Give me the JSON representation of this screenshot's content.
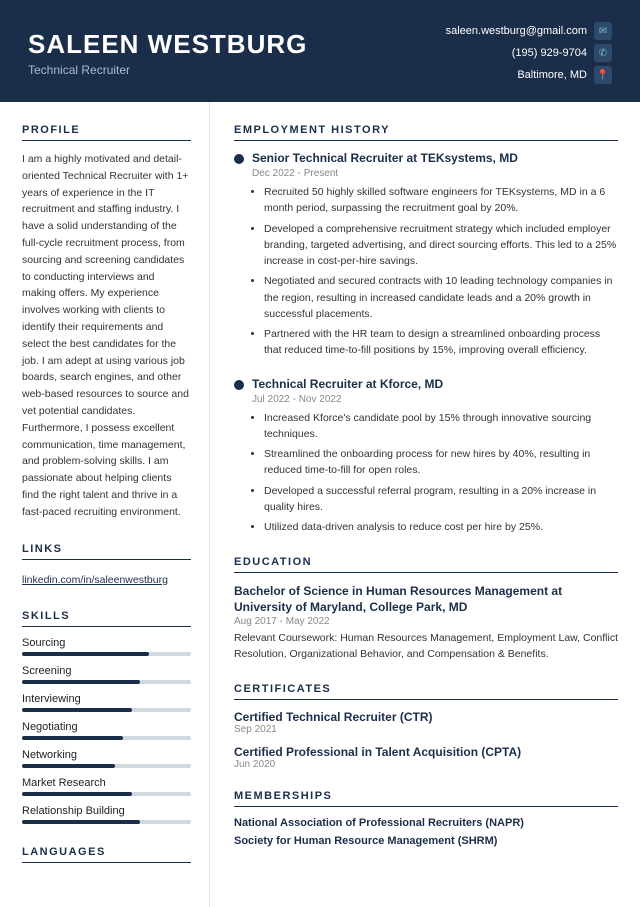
{
  "header": {
    "name": "SALEEN WESTBURG",
    "title": "Technical Recruiter",
    "email": "saleen.westburg@gmail.com",
    "phone": "(195) 929-9704",
    "location": "Baltimore, MD"
  },
  "sidebar": {
    "sections": {
      "profile": {
        "title": "PROFILE",
        "text": "I am a highly motivated and detail-oriented Technical Recruiter with 1+ years of experience in the IT recruitment and staffing industry. I have a solid understanding of the full-cycle recruitment process, from sourcing and screening candidates to conducting interviews and making offers. My experience involves working with clients to identify their requirements and select the best candidates for the job. I am adept at using various job boards, search engines, and other web-based resources to source and vet potential candidates. Furthermore, I possess excellent communication, time management, and problem-solving skills. I am passionate about helping clients find the right talent and thrive in a fast-paced recruiting environment."
      },
      "links": {
        "title": "LINKS",
        "items": [
          "linkedin.com/in/saleenwestburg"
        ]
      },
      "skills": {
        "title": "SKILLS",
        "items": [
          {
            "label": "Sourcing",
            "pct": 75
          },
          {
            "label": "Screening",
            "pct": 70
          },
          {
            "label": "Interviewing",
            "pct": 65
          },
          {
            "label": "Negotiating",
            "pct": 60
          },
          {
            "label": "Networking",
            "pct": 55
          },
          {
            "label": "Market Research",
            "pct": 65
          },
          {
            "label": "Relationship Building",
            "pct": 70
          }
        ]
      },
      "languages": {
        "title": "LANGUAGES"
      }
    }
  },
  "main": {
    "sections": {
      "employment": {
        "title": "EMPLOYMENT HISTORY",
        "jobs": [
          {
            "title": "Senior Technical Recruiter at TEKsystems, MD",
            "dates": "Dec 2022 - Present",
            "bullets": [
              "Recruited 50 highly skilled software engineers for TEKsystems, MD in a 6 month period, surpassing the recruitment goal by 20%.",
              "Developed a comprehensive recruitment strategy which included employer branding, targeted advertising, and direct sourcing efforts. This led to a 25% increase in cost-per-hire savings.",
              "Negotiated and secured contracts with 10 leading technology companies in the region, resulting in increased candidate leads and a 20% growth in successful placements.",
              "Partnered with the HR team to design a streamlined onboarding process that reduced time-to-fill positions by 15%, improving overall efficiency."
            ]
          },
          {
            "title": "Technical Recruiter at Kforce, MD",
            "dates": "Jul 2022 - Nov 2022",
            "bullets": [
              "Increased Kforce's candidate pool by 15% through innovative sourcing techniques.",
              "Streamlined the onboarding process for new hires by 40%, resulting in reduced time-to-fill for open roles.",
              "Developed a successful referral program, resulting in a 20% increase in quality hires.",
              "Utilized data-driven analysis to reduce cost per hire by 25%."
            ]
          }
        ]
      },
      "education": {
        "title": "EDUCATION",
        "items": [
          {
            "degree": "Bachelor of Science in Human Resources Management at University of Maryland, College Park, MD",
            "dates": "Aug 2017 - May 2022",
            "coursework": "Relevant Coursework: Human Resources Management, Employment Law, Conflict Resolution, Organizational Behavior, and Compensation & Benefits."
          }
        ]
      },
      "certificates": {
        "title": "CERTIFICATES",
        "items": [
          {
            "name": "Certified Technical Recruiter (CTR)",
            "date": "Sep 2021"
          },
          {
            "name": "Certified Professional in Talent Acquisition (CPTA)",
            "date": "Jun 2020"
          }
        ]
      },
      "memberships": {
        "title": "MEMBERSHIPS",
        "items": [
          "National Association of Professional Recruiters (NAPR)",
          "Society for Human Resource Management (SHRM)"
        ]
      }
    }
  }
}
